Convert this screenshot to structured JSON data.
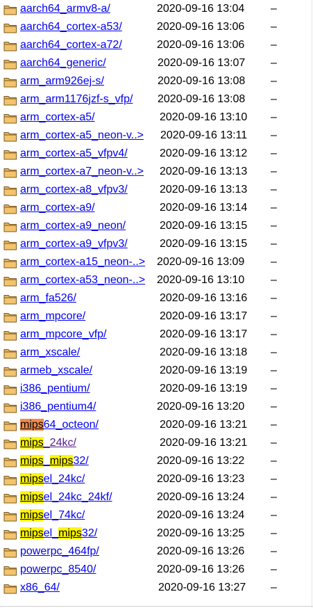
{
  "listing": {
    "entries": [
      {
        "name": "aarch64_armv8-a/",
        "date": "2020-09-16 13:04",
        "size": "–"
      },
      {
        "name": "aarch64_cortex-a53/",
        "date": "2020-09-16 13:06",
        "size": "–"
      },
      {
        "name": "aarch64_cortex-a72/",
        "date": "2020-09-16 13:06",
        "size": "–"
      },
      {
        "name": "aarch64_generic/",
        "date": "2020-09-16 13:07",
        "size": "–"
      },
      {
        "name": "arm_arm926ej-s/",
        "date": "2020-09-16 13:08",
        "size": "–"
      },
      {
        "name": "arm_arm1176jzf-s_vfp/",
        "date": "2020-09-16 13:08",
        "size": "–"
      },
      {
        "name": "arm_cortex-a5/",
        "date": "2020-09-16 13:10",
        "size": "–"
      },
      {
        "name": "arm_cortex-a5_neon-v..>",
        "date": "2020-09-16 13:11",
        "size": "–"
      },
      {
        "name": "arm_cortex-a5_vfpv4/",
        "date": "2020-09-16 13:12",
        "size": "–"
      },
      {
        "name": "arm_cortex-a7_neon-v..>",
        "date": "2020-09-16 13:13",
        "size": "–"
      },
      {
        "name": "arm_cortex-a8_vfpv3/",
        "date": "2020-09-16 13:13",
        "size": "–"
      },
      {
        "name": "arm_cortex-a9/",
        "date": "2020-09-16 13:14",
        "size": "–"
      },
      {
        "name": "arm_cortex-a9_neon/",
        "date": "2020-09-16 13:15",
        "size": "–"
      },
      {
        "name": "arm_cortex-a9_vfpv3/",
        "date": "2020-09-16 13:15",
        "size": "–"
      },
      {
        "name": "arm_cortex-a15_neon-..>",
        "date": "2020-09-16 13:09",
        "size": "–"
      },
      {
        "name": "arm_cortex-a53_neon-..>",
        "date": "2020-09-16 13:10",
        "size": "–"
      },
      {
        "name": "arm_fa526/",
        "date": "2020-09-16 13:16",
        "size": "–"
      },
      {
        "name": "arm_mpcore/",
        "date": "2020-09-16 13:17",
        "size": "–"
      },
      {
        "name": "arm_mpcore_vfp/",
        "date": "2020-09-16 13:17",
        "size": "–"
      },
      {
        "name": "arm_xscale/",
        "date": "2020-09-16 13:18",
        "size": "–"
      },
      {
        "name": "armeb_xscale/",
        "date": "2020-09-16 13:19",
        "size": "–"
      },
      {
        "name": "i386_pentium/",
        "date": "2020-09-16 13:19",
        "size": "–"
      },
      {
        "name": "i386_pentium4/",
        "date": "2020-09-16 13:20",
        "size": "–"
      },
      {
        "name": "mips64_octeon/",
        "date": "2020-09-16 13:21",
        "size": "–",
        "highlight": "orange"
      },
      {
        "name": "mips_24kc/",
        "date": "2020-09-16 13:21",
        "size": "–",
        "highlight": "yellow",
        "visited": true
      },
      {
        "name": "mips_mips32/",
        "date": "2020-09-16 13:22",
        "size": "–",
        "highlight": "yellow"
      },
      {
        "name": "mipsel_24kc/",
        "date": "2020-09-16 13:23",
        "size": "–",
        "highlight": "yellow"
      },
      {
        "name": "mipsel_24kc_24kf/",
        "date": "2020-09-16 13:24",
        "size": "–",
        "highlight": "yellow"
      },
      {
        "name": "mipsel_74kc/",
        "date": "2020-09-16 13:24",
        "size": "–",
        "highlight": "yellow"
      },
      {
        "name": "mipsel_mips32/",
        "date": "2020-09-16 13:25",
        "size": "–",
        "highlight": "yellow"
      },
      {
        "name": "powerpc_464fp/",
        "date": "2020-09-16 13:26",
        "size": "–"
      },
      {
        "name": "powerpc_8540/",
        "date": "2020-09-16 13:26",
        "size": "–"
      },
      {
        "name": "x86_64/",
        "date": "2020-09-16 13:27",
        "size": "–"
      }
    ],
    "search_term": "mips",
    "colors": {
      "link": "#0000ee",
      "visited_link": "#551a8b",
      "match_highlight": "#fff600",
      "current_match_highlight": "#f08c4b"
    }
  }
}
